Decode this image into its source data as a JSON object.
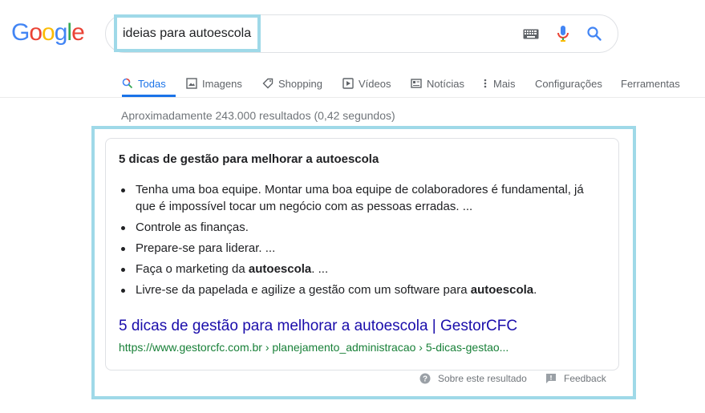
{
  "logo": {
    "letters": [
      "G",
      "o",
      "o",
      "g",
      "l",
      "e"
    ]
  },
  "search": {
    "query": "ideias para autoescola"
  },
  "tabs": [
    {
      "label": "Todas",
      "icon": "search-icon",
      "active": true
    },
    {
      "label": "Imagens",
      "icon": "image-icon"
    },
    {
      "label": "Shopping",
      "icon": "tag-icon"
    },
    {
      "label": "Vídeos",
      "icon": "play-icon"
    },
    {
      "label": "Notícias",
      "icon": "news-icon"
    },
    {
      "label": "Mais",
      "icon": "more-vert-icon"
    },
    {
      "label": "Configurações"
    },
    {
      "label": "Ferramentas"
    }
  ],
  "stats": "Aproximadamente 243.000 resultados (0,42 segundos)",
  "snippet": {
    "title": "5 dicas de gestão para melhorar a autoescola",
    "items": [
      {
        "text": "Tenha uma boa equipe. Montar uma boa equipe de colaboradores é fundamental, já que é impossível tocar um negócio com as pessoas erradas. ..."
      },
      {
        "text": "Controle as finanças."
      },
      {
        "text": "Prepare-se para liderar. ..."
      },
      {
        "pre": "Faça o marketing da ",
        "bold": "autoescola",
        "post": ". ..."
      },
      {
        "pre": "Livre-se da papelada e agilize a gestão com um software para ",
        "bold": "autoescola",
        "post": "."
      }
    ],
    "link": "5 dicas de gestão para melhorar a autoescola | GestorCFC",
    "url": "https://www.gestorcfc.com.br › planejamento_administracao › 5-dicas-gestao..."
  },
  "footer": {
    "about": "Sobre este resultado",
    "feedback": "Feedback"
  }
}
